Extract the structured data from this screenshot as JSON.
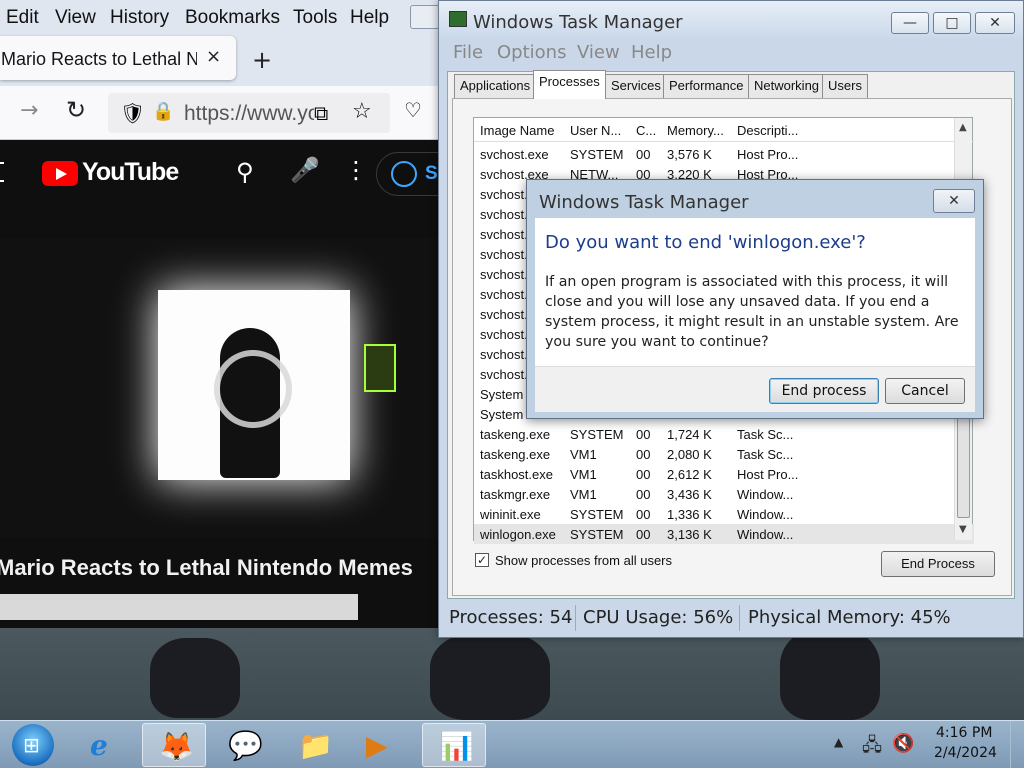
{
  "browser": {
    "menu": [
      "Edit",
      "View",
      "History",
      "Bookmarks",
      "Tools",
      "Help"
    ],
    "tab_title": "Mario Reacts to Lethal Nintendo Memes",
    "tab_close": "×",
    "new_tab": "+",
    "url": "https://www.youtube.com",
    "icons": {
      "forward": "→",
      "reload": "↻",
      "shield": "🛡",
      "lock": "🔒",
      "pip": "⧉",
      "star": "☆",
      "pocket": "♡"
    }
  },
  "youtube": {
    "logo_text": "YouTube",
    "signin_text": "Si",
    "video_title": "Mario Reacts to Lethal Nintendo Memes",
    "icons": {
      "search": "⚲",
      "mic": "🎤",
      "more": "⋮"
    }
  },
  "task_manager": {
    "title": "Windows Task Manager",
    "title_buttons": {
      "minimize": "—",
      "maximize": "□",
      "close": "✕"
    },
    "menu": [
      "File",
      "Options",
      "View",
      "Help"
    ],
    "tabs": [
      "Applications",
      "Processes",
      "Services",
      "Performance",
      "Networking",
      "Users"
    ],
    "active_tab": "Processes",
    "columns": [
      "Image Name",
      "User N...",
      "C...",
      "Memory...",
      "Descripti..."
    ],
    "rows": [
      [
        "svchost.exe",
        "SYSTEM",
        "00",
        "3,576 K",
        "Host Pro..."
      ],
      [
        "svchost.exe",
        "NETW...",
        "00",
        "3,220 K",
        "Host Pro..."
      ],
      [
        "svchost.",
        "",
        "",
        "",
        ""
      ],
      [
        "svchost.",
        "",
        "",
        "",
        ""
      ],
      [
        "svchost.",
        "",
        "",
        "",
        ""
      ],
      [
        "svchost.",
        "",
        "",
        "",
        ""
      ],
      [
        "svchost.",
        "",
        "",
        "",
        ""
      ],
      [
        "svchost.",
        "",
        "",
        "",
        ""
      ],
      [
        "svchost.",
        "",
        "",
        "",
        ""
      ],
      [
        "svchost.",
        "",
        "",
        "",
        ""
      ],
      [
        "svchost.",
        "",
        "",
        "",
        ""
      ],
      [
        "svchost.",
        "",
        "",
        "",
        ""
      ],
      [
        "System",
        "",
        "",
        "",
        ""
      ],
      [
        "System",
        "",
        "",
        "",
        ""
      ],
      [
        "taskeng.exe",
        "SYSTEM",
        "00",
        "1,724 K",
        "Task Sc..."
      ],
      [
        "taskeng.exe",
        "VM1",
        "00",
        "2,080 K",
        "Task Sc..."
      ],
      [
        "taskhost.exe",
        "VM1",
        "00",
        "2,612 K",
        "Host Pro..."
      ],
      [
        "taskmgr.exe",
        "VM1",
        "00",
        "3,436 K",
        "Window..."
      ],
      [
        "wininit.exe",
        "SYSTEM",
        "00",
        "1,336 K",
        "Window..."
      ],
      [
        "winlogon.exe",
        "SYSTEM",
        "00",
        "3,136 K",
        "Window..."
      ]
    ],
    "selected_row": "winlogon.exe",
    "show_all_label": "Show processes from all users",
    "show_all_checked": true,
    "check_mark": "✓",
    "end_process_label": "End Process",
    "status": {
      "processes": "Processes: 54",
      "cpu": "CPU Usage: 56%",
      "memory": "Physical Memory: 45%"
    }
  },
  "dialog": {
    "title": "Windows Task Manager",
    "close": "✕",
    "heading": "Do you want to end 'winlogon.exe'?",
    "message": "If an open program is associated with this process, it will close and you will lose any unsaved data. If you end a system process, it might result in an unstable system. Are you sure you want to continue?",
    "confirm_label": "End process",
    "cancel_label": "Cancel"
  },
  "taskbar": {
    "start_glyph": "⊞",
    "apps": [
      {
        "name": "internet-explorer",
        "glyph": "e"
      },
      {
        "name": "firefox",
        "glyph": "🦊"
      },
      {
        "name": "chat",
        "glyph": "💬"
      },
      {
        "name": "explorer",
        "glyph": "📁"
      },
      {
        "name": "media-player",
        "glyph": "▶"
      },
      {
        "name": "task-manager",
        "glyph": "📊"
      }
    ],
    "tray": {
      "show_hidden": "▲",
      "network": "🖧",
      "volume": "🔇"
    },
    "time": "4:16 PM",
    "date": "2/4/2024"
  },
  "colors": {
    "accent": "#1c3c8c",
    "youtube_red": "#ff0000",
    "selection": "#e5e5e5"
  }
}
